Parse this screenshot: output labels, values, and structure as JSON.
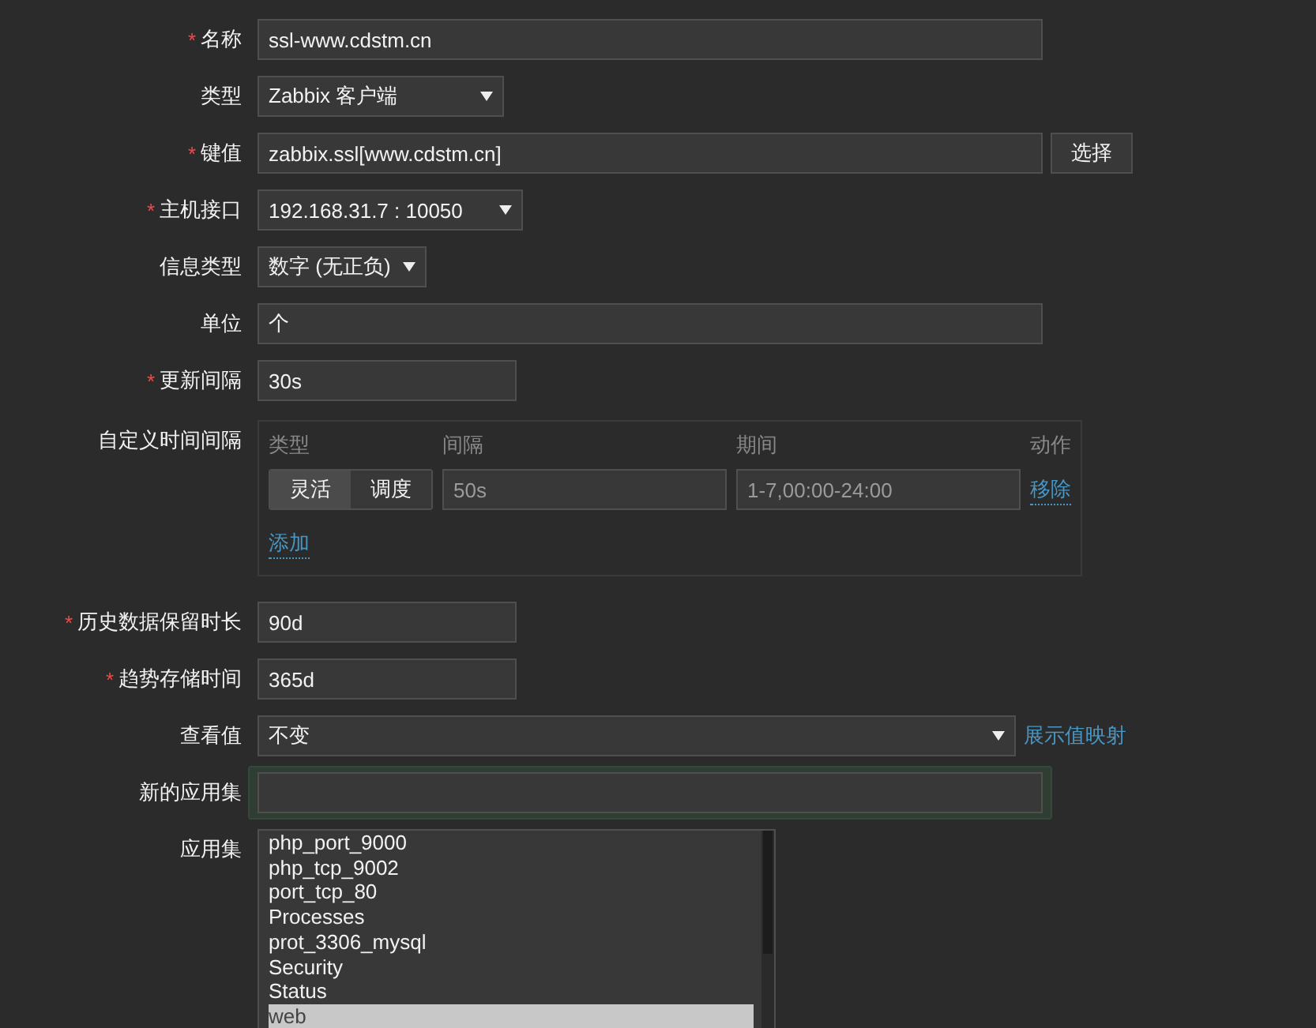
{
  "fields": [
    {
      "kind": "text",
      "label": "名称",
      "required_mark": "*",
      "value": "ssl-www.cdstm.cn"
    },
    {
      "kind": "select",
      "label": "类型",
      "value": "Zabbix 客户端"
    },
    {
      "kind": "text-button",
      "label": "键值",
      "required_mark": "*",
      "value": "zabbix.ssl[www.cdstm.cn]",
      "button": "选择"
    },
    {
      "kind": "select",
      "label": "主机接口",
      "required_mark": "*",
      "value": "192.168.31.7 : 10050"
    },
    {
      "kind": "select",
      "label": "信息类型",
      "value": "数字 (无正负)"
    },
    {
      "kind": "text",
      "label": "单位",
      "value": "个"
    },
    {
      "kind": "text",
      "label": "更新间隔",
      "required_mark": "*",
      "value": "30s"
    },
    {
      "kind": "intervals",
      "label": "自定义时间间隔",
      "columns": [
        "类型",
        "间隔",
        "期间",
        "动作"
      ],
      "rows": [
        {
          "modes": [
            {
              "label": "灵活",
              "selected": true
            },
            {
              "label": "调度",
              "selected": false
            }
          ],
          "interval": "50s",
          "period": "1-7,00:00-24:00",
          "action": "移除"
        }
      ],
      "add": "添加"
    },
    {
      "kind": "text",
      "label": "历史数据保留时长",
      "required_mark": "*",
      "value": "90d"
    },
    {
      "kind": "text",
      "label": "趋势存储时间",
      "required_mark": "*",
      "value": "365d"
    },
    {
      "kind": "select-link",
      "label": "查看值",
      "value": "不变",
      "link": "展示值映射"
    },
    {
      "kind": "focused",
      "label": "新的应用集"
    },
    {
      "kind": "listbox",
      "label": "应用集",
      "items": [
        {
          "label": "php_port_9000",
          "selected": false
        },
        {
          "label": "php_tcp_9002",
          "selected": false
        },
        {
          "label": "port_tcp_80",
          "selected": false
        },
        {
          "label": "Processes",
          "selected": false
        },
        {
          "label": "prot_3306_mysql",
          "selected": false
        },
        {
          "label": "Security",
          "selected": false
        },
        {
          "label": "Status",
          "selected": false
        },
        {
          "label": "web",
          "selected": true
        }
      ]
    }
  ]
}
